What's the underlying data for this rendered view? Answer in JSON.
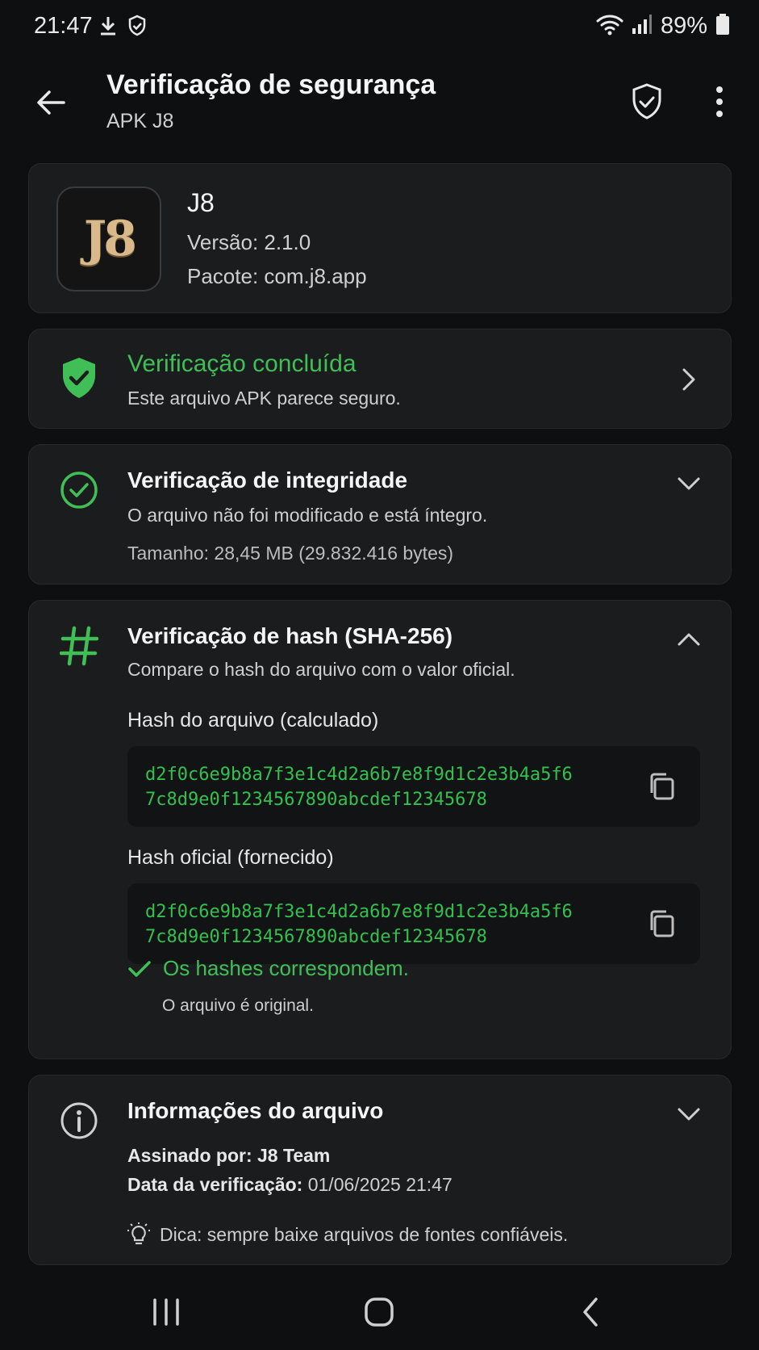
{
  "status_bar": {
    "time": "21:47",
    "battery": "89%",
    "icons": [
      "download-icon",
      "shield-check-icon",
      "wifi-icon",
      "signal-icon",
      "battery-icon"
    ]
  },
  "app_bar": {
    "title": "Verificação de segurança",
    "subtitle": "APK J8",
    "icons": [
      "back-arrow-icon",
      "shield-check-icon",
      "more-vert-icon"
    ]
  },
  "app_card": {
    "icon_text": "J8",
    "name": "J8",
    "version": "Versão: 2.1.0",
    "package": "Pacote: com.j8.app"
  },
  "verification_done": {
    "title": "Verificação concluída",
    "subtitle": "Este arquivo APK parece seguro."
  },
  "integrity": {
    "title": "Verificação de integridade",
    "subtitle": "O arquivo não foi modificado e está íntegro.",
    "size": "Tamanho: 28,45 MB (29.832.416 bytes)"
  },
  "hash": {
    "title": "Verificação de hash (SHA-256)",
    "subtitle": "Compare o hash do arquivo com o valor oficial.",
    "calc_label": "Hash do arquivo (calculado)",
    "calc_value": "d2f0c6e9b8a7f3e1c4d2a6b7e8f9d1c2e3b4a5f6\n7c8d9e0f1234567890abcdef12345678",
    "official_label": "Hash oficial (fornecido)",
    "official_value": "d2f0c6e9b8a7f3e1c4d2a6b7e8f9d1c2e3b4a5f6\n7c8d9e0f1234567890abcdef12345678",
    "match_title": "Os hashes correspondem.",
    "match_sub": "O arquivo é original."
  },
  "file_info": {
    "title": "Informações do arquivo",
    "signed_label": "Assinado por:",
    "signed_value": "J8 Team",
    "date_label": "Data da verificação:",
    "date_value": "01/06/2025 21:47",
    "tip": "Dica: sempre baixe arquivos de fontes confiáveis."
  },
  "colors": {
    "background": "#0e0f10",
    "card": "#1b1c1e",
    "accent_green": "#3fbf55"
  }
}
